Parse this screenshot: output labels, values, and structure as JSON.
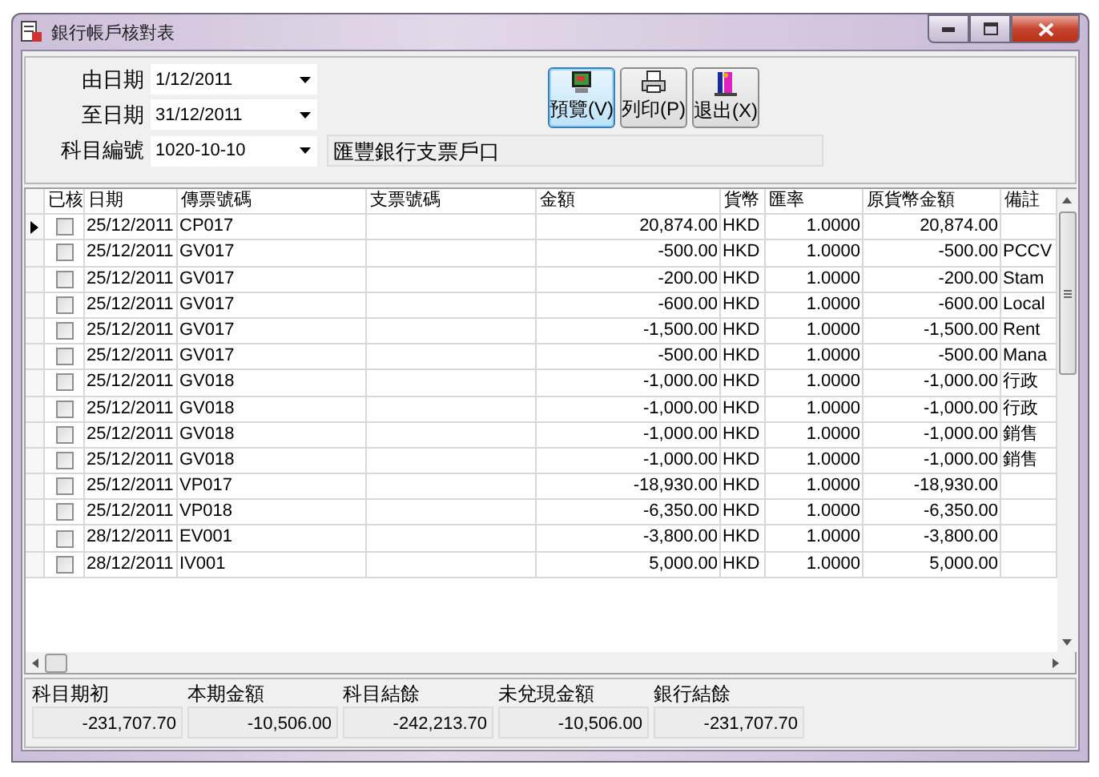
{
  "window": {
    "title": "銀行帳戶核對表"
  },
  "filters": [
    {
      "label": "由日期",
      "value": "1/12/2011"
    },
    {
      "label": "至日期",
      "value": "31/12/2011"
    }
  ],
  "account": {
    "label": "科目編號",
    "value": "1020-10-10",
    "description": "匯豐銀行支票戶口"
  },
  "buttons": [
    {
      "label": "預覽(V)",
      "kind": "preview",
      "focused": true
    },
    {
      "label": "列印(P)",
      "kind": "print",
      "focused": false
    },
    {
      "label": "退出(X)",
      "kind": "exit",
      "focused": false
    }
  ],
  "table": {
    "columns": [
      "已核",
      "日期",
      "傳票號碼",
      "支票號碼",
      "金額",
      "貨幣",
      "匯率",
      "原貨幣金額",
      "備註"
    ],
    "rows": [
      {
        "selected": true,
        "checked": false,
        "date": "25/12/2011",
        "voucher": "CP017",
        "cheque": "",
        "amount": "20,874.00",
        "currency": "HKD",
        "rate": "1.0000",
        "original": "20,874.00",
        "remark": ""
      },
      {
        "selected": false,
        "checked": false,
        "date": "25/12/2011",
        "voucher": "GV017",
        "cheque": "",
        "amount": "-500.00",
        "currency": "HKD",
        "rate": "1.0000",
        "original": "-500.00",
        "remark": "PCCV"
      },
      {
        "selected": false,
        "checked": false,
        "date": "25/12/2011",
        "voucher": "GV017",
        "cheque": "",
        "amount": "-200.00",
        "currency": "HKD",
        "rate": "1.0000",
        "original": "-200.00",
        "remark": "Stam"
      },
      {
        "selected": false,
        "checked": false,
        "date": "25/12/2011",
        "voucher": "GV017",
        "cheque": "",
        "amount": "-600.00",
        "currency": "HKD",
        "rate": "1.0000",
        "original": "-600.00",
        "remark": "Local"
      },
      {
        "selected": false,
        "checked": false,
        "date": "25/12/2011",
        "voucher": "GV017",
        "cheque": "",
        "amount": "-1,500.00",
        "currency": "HKD",
        "rate": "1.0000",
        "original": "-1,500.00",
        "remark": "Rent"
      },
      {
        "selected": false,
        "checked": false,
        "date": "25/12/2011",
        "voucher": "GV017",
        "cheque": "",
        "amount": "-500.00",
        "currency": "HKD",
        "rate": "1.0000",
        "original": "-500.00",
        "remark": "Mana"
      },
      {
        "selected": false,
        "checked": false,
        "date": "25/12/2011",
        "voucher": "GV018",
        "cheque": "",
        "amount": "-1,000.00",
        "currency": "HKD",
        "rate": "1.0000",
        "original": "-1,000.00",
        "remark": "行政"
      },
      {
        "selected": false,
        "checked": false,
        "date": "25/12/2011",
        "voucher": "GV018",
        "cheque": "",
        "amount": "-1,000.00",
        "currency": "HKD",
        "rate": "1.0000",
        "original": "-1,000.00",
        "remark": "行政"
      },
      {
        "selected": false,
        "checked": false,
        "date": "25/12/2011",
        "voucher": "GV018",
        "cheque": "",
        "amount": "-1,000.00",
        "currency": "HKD",
        "rate": "1.0000",
        "original": "-1,000.00",
        "remark": "銷售"
      },
      {
        "selected": false,
        "checked": false,
        "date": "25/12/2011",
        "voucher": "GV018",
        "cheque": "",
        "amount": "-1,000.00",
        "currency": "HKD",
        "rate": "1.0000",
        "original": "-1,000.00",
        "remark": "銷售"
      },
      {
        "selected": false,
        "checked": false,
        "date": "25/12/2011",
        "voucher": "VP017",
        "cheque": "",
        "amount": "-18,930.00",
        "currency": "HKD",
        "rate": "1.0000",
        "original": "-18,930.00",
        "remark": ""
      },
      {
        "selected": false,
        "checked": false,
        "date": "25/12/2011",
        "voucher": "VP018",
        "cheque": "",
        "amount": "-6,350.00",
        "currency": "HKD",
        "rate": "1.0000",
        "original": "-6,350.00",
        "remark": ""
      },
      {
        "selected": false,
        "checked": false,
        "date": "28/12/2011",
        "voucher": "EV001",
        "cheque": "",
        "amount": "-3,800.00",
        "currency": "HKD",
        "rate": "1.0000",
        "original": "-3,800.00",
        "remark": ""
      },
      {
        "selected": false,
        "checked": false,
        "date": "28/12/2011",
        "voucher": "IV001",
        "cheque": "",
        "amount": "5,000.00",
        "currency": "HKD",
        "rate": "1.0000",
        "original": "5,000.00",
        "remark": ""
      }
    ]
  },
  "totals": [
    {
      "label": "科目期初",
      "value": "-231,707.70"
    },
    {
      "label": "本期金額",
      "value": "-10,506.00"
    },
    {
      "label": "科目結餘",
      "value": "-242,213.70"
    },
    {
      "label": "未兌現金額",
      "value": "-10,506.00"
    },
    {
      "label": "銀行結餘",
      "value": "-231,707.70"
    }
  ]
}
